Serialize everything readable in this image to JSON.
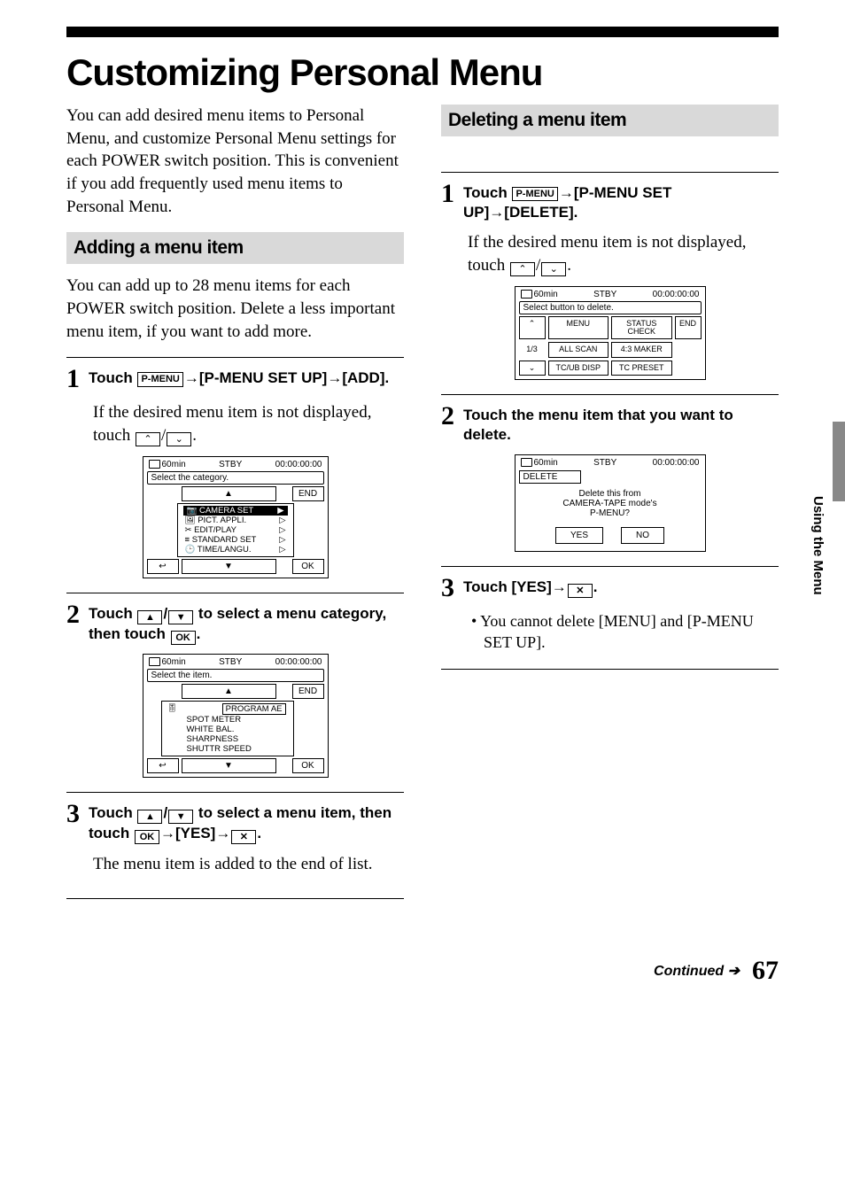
{
  "title": "Customizing Personal Menu",
  "intro": "You can add desired menu items to Personal Menu, and customize Personal Menu settings for each POWER switch position. This is convenient if you add frequently used menu items to Personal Menu.",
  "sidebar_label": "Using the Menu",
  "footer": {
    "continued": "Continued",
    "page": "67"
  },
  "buttons": {
    "pmenu": "P-MENU",
    "ok": "OK",
    "up": "▲",
    "down": "▼",
    "dbl_up": "⌃",
    "dbl_down": "⌄",
    "x": "✕",
    "end": "END",
    "return": "⤴"
  },
  "adding": {
    "heading": "Adding a menu item",
    "intro": "You can add up to 28 menu items for each POWER switch position. Delete a less important menu item, if you want to add more.",
    "step1": {
      "num": "1",
      "head_a": "Touch ",
      "head_b": "→[P-MENU SET UP]→[ADD].",
      "body_a": "If the desired menu item is not displayed, touch ",
      "body_b": "/",
      "body_c": "."
    },
    "step2": {
      "num": "2",
      "head_a": "Touch ",
      "head_b": "/",
      "head_c": " to select a menu category, then touch ",
      "head_d": "."
    },
    "step3": {
      "num": "3",
      "head_a": "Touch ",
      "head_b": "/",
      "head_c": " to select a menu item, then touch ",
      "head_d": "→[YES]→",
      "head_e": ".",
      "body": "The menu item is added to the end of list."
    }
  },
  "deleting": {
    "heading": "Deleting a menu item",
    "step1": {
      "num": "1",
      "head_a": "Touch ",
      "head_b": "→[P-MENU SET UP]→[DELETE].",
      "body_a": "If the desired menu item is not displayed, touch ",
      "body_b": "/",
      "body_c": "."
    },
    "step2": {
      "num": "2",
      "head": "Touch the menu item that you want to delete."
    },
    "step3": {
      "num": "3",
      "head_a": "Touch [YES]→",
      "head_b": ".",
      "bullet": "• You cannot delete [MENU] and [P-MENU SET UP]."
    }
  },
  "lcd1": {
    "tape": "60min",
    "mode": "STBY",
    "tc": "00:00:00:00",
    "subtitle": "Select the category.",
    "end": "END",
    "items": [
      "CAMERA SET",
      "PICT. APPLI.",
      "EDIT/PLAY",
      "STANDARD SET",
      "TIME/LANGU."
    ],
    "return": "↩",
    "ok": "OK"
  },
  "lcd2": {
    "tape": "60min",
    "mode": "STBY",
    "tc": "00:00:00:00",
    "subtitle": "Select the item.",
    "end": "END",
    "items": [
      "PROGRAM AE",
      "SPOT METER",
      "WHITE BAL.",
      "SHARPNESS",
      "SHUTTR SPEED"
    ],
    "return": "↩",
    "ok": "OK"
  },
  "lcd3": {
    "tape": "60min",
    "mode": "STBY",
    "tc": "00:00:00:00",
    "subtitle": "Select button to delete.",
    "page": "1/3",
    "end": "END",
    "cells": [
      "MENU",
      "STATUS CHECK",
      "ALL SCAN",
      "4:3 MAKER",
      "TC/UB DISP",
      "TC PRESET"
    ]
  },
  "lcd4": {
    "tape": "60min",
    "mode": "STBY",
    "tc": "00:00:00:00",
    "title": "DELETE",
    "msg1": "Delete this from",
    "msg2": "CAMERA-TAPE mode's",
    "msg3": "P-MENU?",
    "yes": "YES",
    "no": "NO"
  }
}
